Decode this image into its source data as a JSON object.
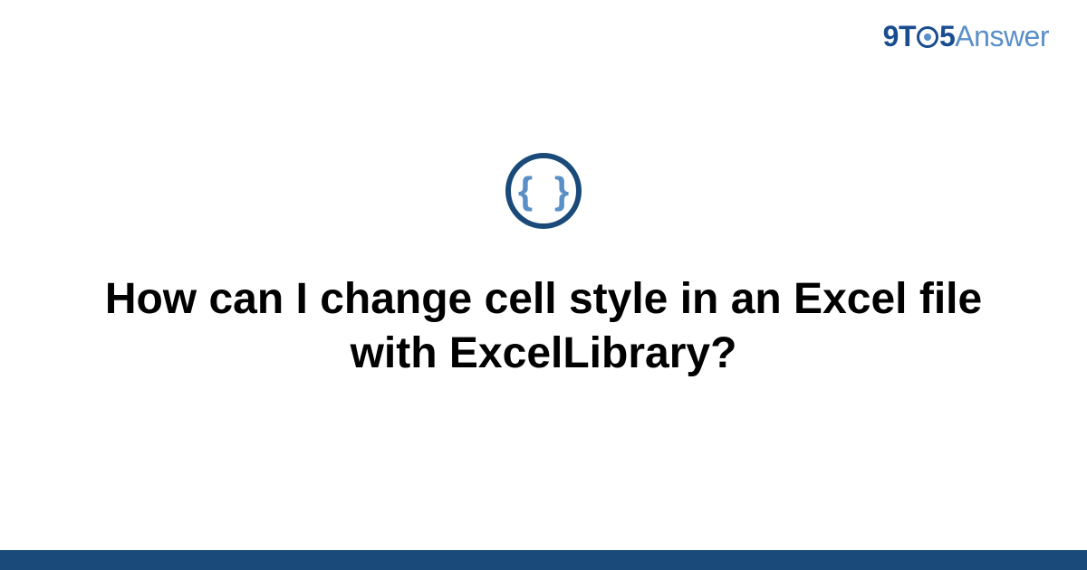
{
  "logo": {
    "part1": "9T",
    "part2": "5",
    "part3": "Answer"
  },
  "icon": {
    "name": "code-braces-icon",
    "glyph": "{ }"
  },
  "title": "How can I change cell style in an Excel file with ExcelLibrary?",
  "colors": {
    "brand_dark": "#194a7a",
    "brand_light": "#5a8fc7"
  }
}
